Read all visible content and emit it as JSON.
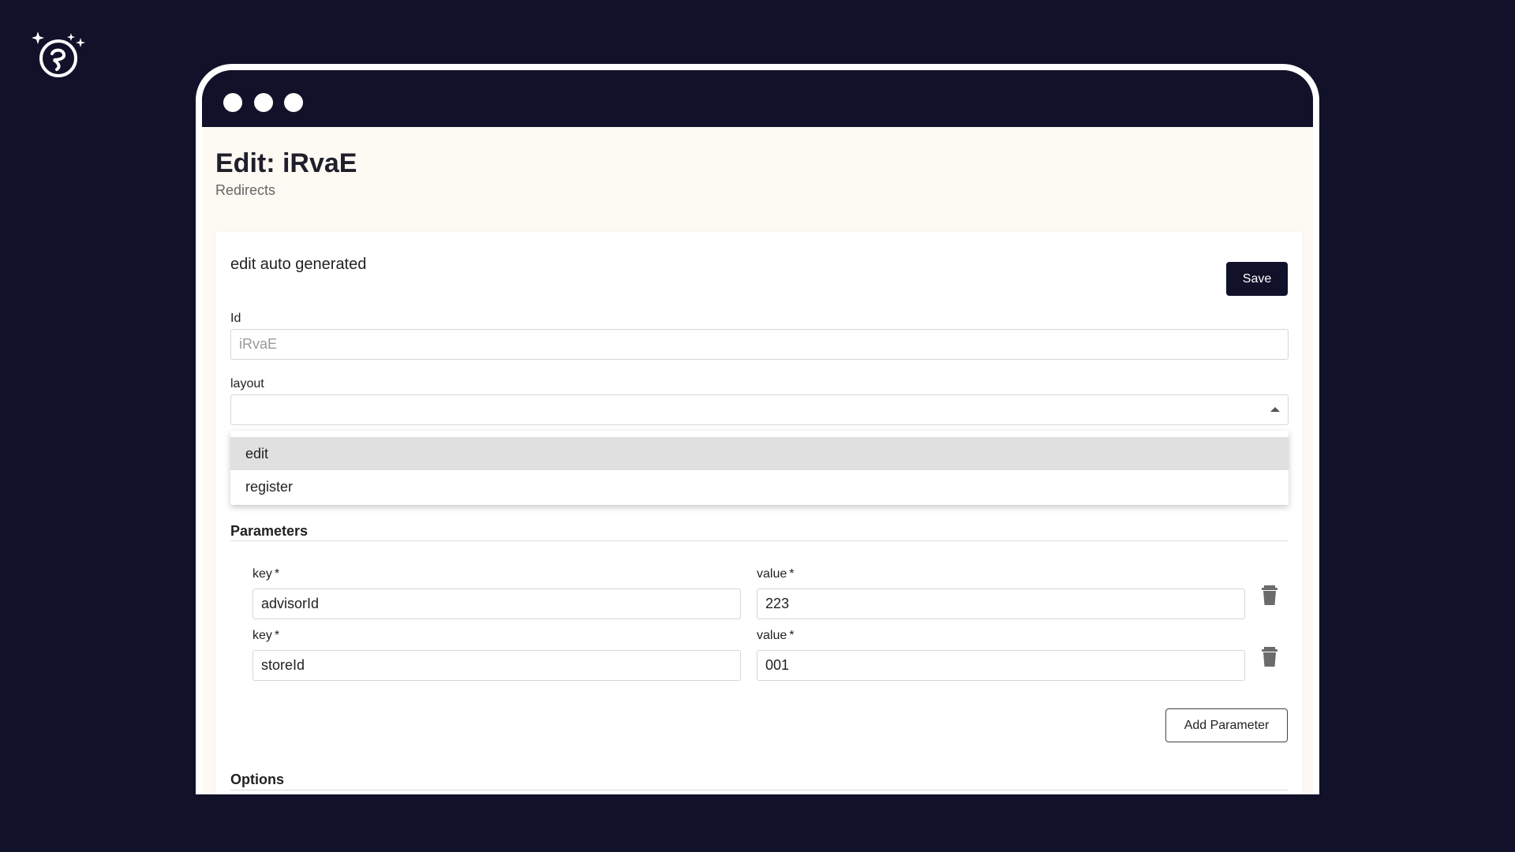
{
  "page": {
    "title": "Edit: iRvaE",
    "subtitle": "Redirects"
  },
  "form": {
    "heading": "edit auto generated",
    "save_label": "Save",
    "id_label": "Id",
    "id_value": "iRvaE",
    "layout_label": "layout",
    "layout_value": "",
    "layout_options": [
      "edit",
      "register"
    ],
    "layout_highlighted": "edit"
  },
  "parameters": {
    "section_title": "Parameters",
    "key_label": "key",
    "value_label": "value",
    "required_marker": "*",
    "rows": [
      {
        "key": "advisorId",
        "value": "223"
      },
      {
        "key": "storeId",
        "value": "001"
      }
    ],
    "add_label": "Add Parameter"
  },
  "options": {
    "section_title": "Options"
  },
  "colors": {
    "background": "#11112a",
    "page_background": "#fdf9f3",
    "primary_button": "#11112a",
    "highlight": "#e0e0e0"
  },
  "icons": {
    "brand": "brand-logo-icon",
    "delete": "trash-icon",
    "select": "caret-up-icon"
  }
}
